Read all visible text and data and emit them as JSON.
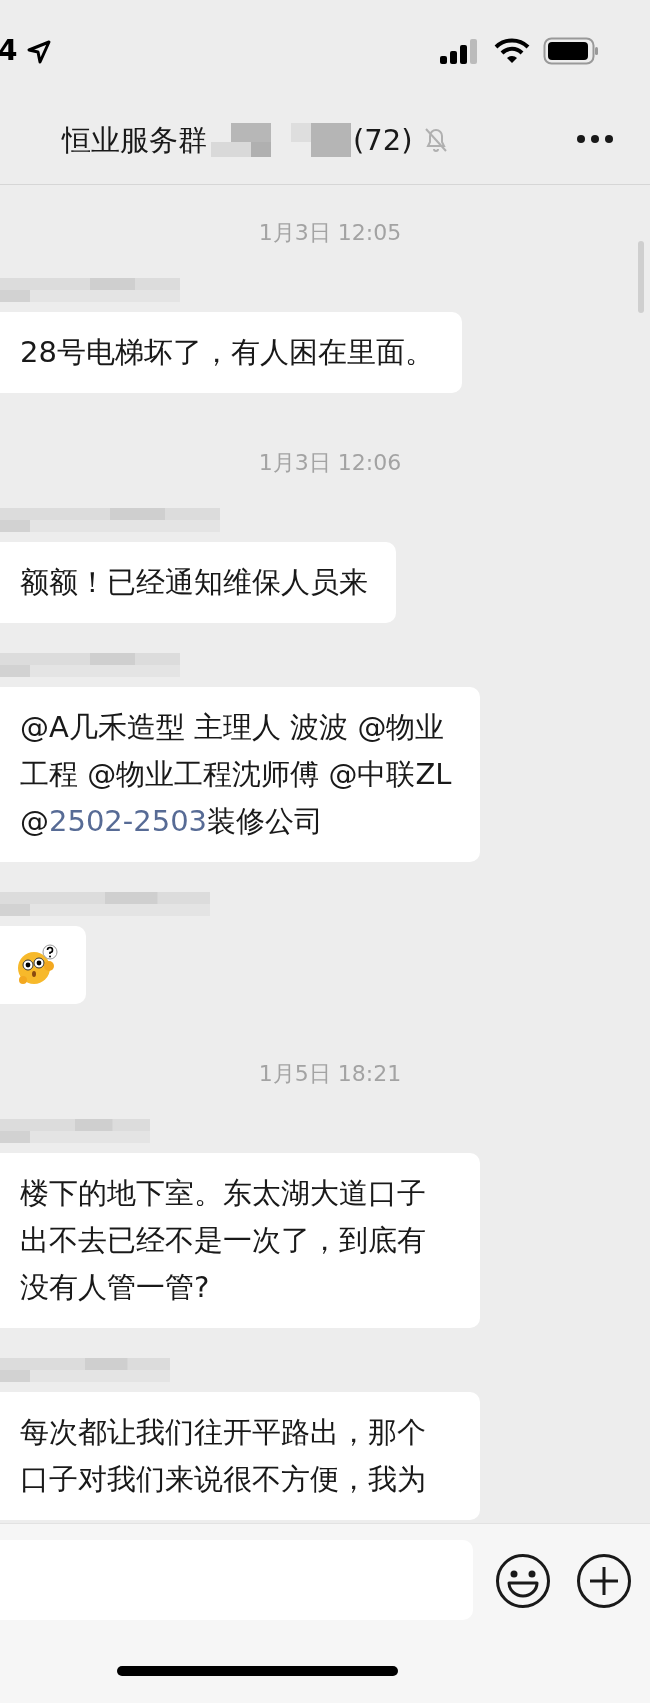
{
  "status_bar": {
    "time": "4",
    "location_on": true
  },
  "header": {
    "title": "恒业服务群",
    "title_obscured": true,
    "member_count": "(72)",
    "muted": true
  },
  "messages": [
    {
      "kind": "timestamp",
      "text": "1月3日 12:05"
    },
    {
      "kind": "text",
      "sender_obscured": true,
      "parts": [
        {
          "kind": "plain",
          "text": "28号电梯坏了，有人困在里面。"
        }
      ]
    },
    {
      "kind": "timestamp",
      "text": "1月3日 12:06"
    },
    {
      "kind": "text",
      "sender_obscured": true,
      "parts": [
        {
          "kind": "plain",
          "text": "额额！已经通知维保人员来"
        }
      ]
    },
    {
      "kind": "text",
      "sender_obscured": true,
      "parts": [
        {
          "kind": "plain",
          "text": "@A几禾造型 主理人 波波 @物业工程 @物业工程沈师傅 @中联ZL @"
        },
        {
          "kind": "link",
          "text": "2502-2503"
        },
        {
          "kind": "plain",
          "text": "装修公司"
        }
      ]
    },
    {
      "kind": "sticker",
      "sender_obscured": true
    },
    {
      "kind": "timestamp",
      "text": "1月5日 18:21"
    },
    {
      "kind": "text",
      "sender_obscured": true,
      "parts": [
        {
          "kind": "plain",
          "text": "楼下的地下室。东太湖大道口子出不去已经不是一次了，到底有没有人管一管?"
        }
      ]
    },
    {
      "kind": "text",
      "sender_obscured": true,
      "parts": [
        {
          "kind": "plain",
          "text": "每次都让我们往开平路出，那个口子对我们来说很不方便，我为"
        }
      ]
    }
  ]
}
